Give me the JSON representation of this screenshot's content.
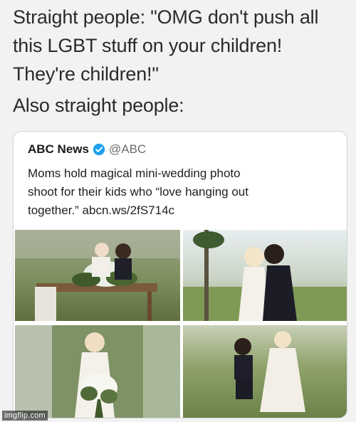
{
  "caption": {
    "lines": [
      "Straight people: \"OMG don't push all",
      "this LGBT stuff on your children!",
      "They're children!\""
    ],
    "also": "Also straight people:"
  },
  "tweet": {
    "name": "ABC News",
    "handle": "@ABC",
    "verified_icon": "verified-badge-icon",
    "text_lines": [
      "Moms hold magical mini-wedding photo",
      "shoot for their kids who “love hanging out",
      "together.” abcn.ws/2fS714c"
    ]
  },
  "watermark": "imgflip.com",
  "colors": {
    "background": "#f2f2f2",
    "card": "#ffffff",
    "verified": "#1da1f2",
    "handle": "#6b6b6b"
  }
}
